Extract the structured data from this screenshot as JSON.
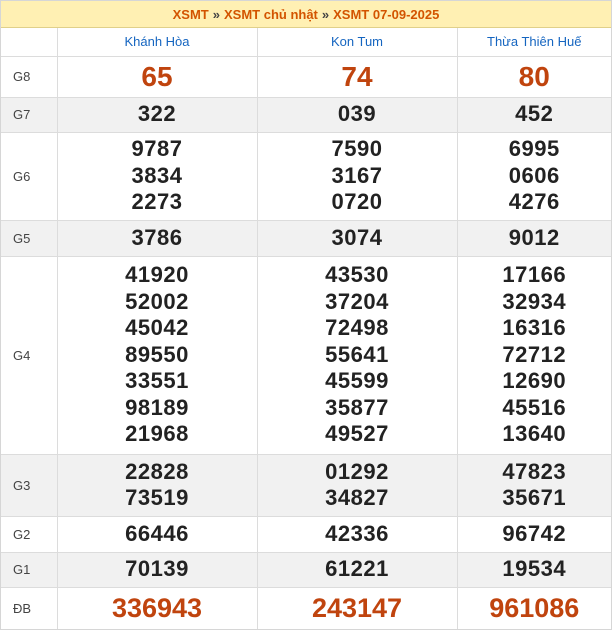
{
  "breadcrumb": {
    "item1": "XSMT",
    "item2": "XSMT chủ nhật",
    "item3": "XSMT 07-09-2025",
    "separator": "»"
  },
  "provinces": [
    "Khánh Hòa",
    "Kon Tum",
    "Thừa Thiên Huế"
  ],
  "prizes": {
    "g8": {
      "label": "G8",
      "values": [
        [
          "65"
        ],
        [
          "74"
        ],
        [
          "80"
        ]
      ]
    },
    "g7": {
      "label": "G7",
      "values": [
        [
          "322"
        ],
        [
          "039"
        ],
        [
          "452"
        ]
      ]
    },
    "g6": {
      "label": "G6",
      "values": [
        [
          "9787",
          "3834",
          "2273"
        ],
        [
          "7590",
          "3167",
          "0720"
        ],
        [
          "6995",
          "0606",
          "4276"
        ]
      ]
    },
    "g5": {
      "label": "G5",
      "values": [
        [
          "3786"
        ],
        [
          "3074"
        ],
        [
          "9012"
        ]
      ]
    },
    "g4": {
      "label": "G4",
      "values": [
        [
          "41920",
          "52002",
          "45042",
          "89550",
          "33551",
          "98189",
          "21968"
        ],
        [
          "43530",
          "37204",
          "72498",
          "55641",
          "45599",
          "35877",
          "49527"
        ],
        [
          "17166",
          "32934",
          "16316",
          "72712",
          "12690",
          "45516",
          "13640"
        ]
      ]
    },
    "g3": {
      "label": "G3",
      "values": [
        [
          "22828",
          "73519"
        ],
        [
          "01292",
          "34827"
        ],
        [
          "47823",
          "35671"
        ]
      ]
    },
    "g2": {
      "label": "G2",
      "values": [
        [
          "66446"
        ],
        [
          "42336"
        ],
        [
          "96742"
        ]
      ]
    },
    "g1": {
      "label": "G1",
      "values": [
        [
          "70139"
        ],
        [
          "61221"
        ],
        [
          "19534"
        ]
      ]
    },
    "db": {
      "label": "ĐB",
      "values": [
        [
          "336943"
        ],
        [
          "243147"
        ],
        [
          "961086"
        ]
      ]
    }
  },
  "colors": {
    "accent": "#c0440e",
    "link": "#1565c0",
    "header_bg": "#fff0b3",
    "alt_row_bg": "#f1f1f1"
  }
}
